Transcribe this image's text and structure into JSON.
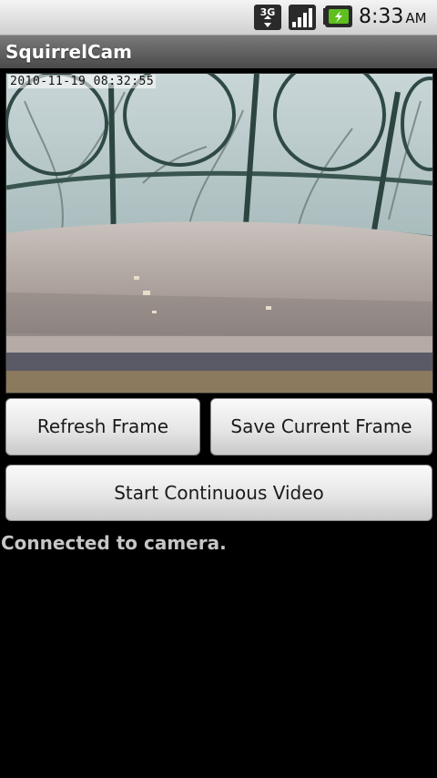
{
  "status_bar": {
    "network_icon": "3g-data-icon",
    "signal_icon": "signal-strength-icon",
    "battery_icon": "battery-charging-icon",
    "time": "8:33",
    "ampm": "AM"
  },
  "app": {
    "title": "SquirrelCam"
  },
  "camera": {
    "timestamp": "2010-11-19 08:32:55"
  },
  "buttons": {
    "refresh_label": "Refresh Frame",
    "save_label": "Save Current Frame",
    "video_label": "Start Continuous Video"
  },
  "status": {
    "message": "Connected to camera."
  },
  "colors": {
    "status_bar_bg": "#e0e0e0",
    "title_bar_bg": "#5e5e5e",
    "background": "#000000",
    "status_text": "#c6c6c6",
    "battery_accent": "#5fbf1f"
  }
}
